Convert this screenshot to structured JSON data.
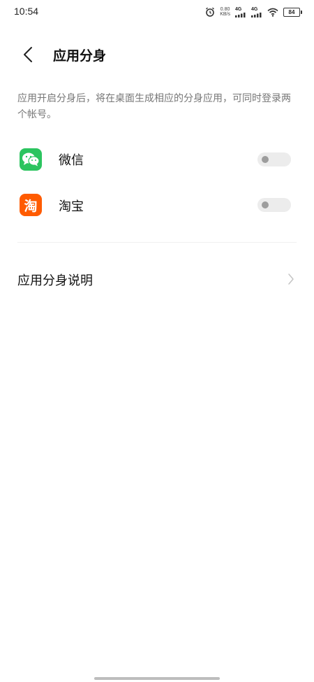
{
  "status_bar": {
    "time": "10:54",
    "net_speed_value": "0.80",
    "net_speed_unit": "KB/s",
    "sim1_label": "4G",
    "sim2_label": "4G",
    "battery_level": "84"
  },
  "header": {
    "title": "应用分身",
    "back_icon": "chevron-left-icon"
  },
  "description": "应用开启分身后，将在桌面生成相应的分身应用，可同时登录两个帐号。",
  "apps": [
    {
      "label": "微信",
      "icon": "wechat-icon",
      "icon_color": "#2BC45F",
      "enabled": false
    },
    {
      "label": "淘宝",
      "icon": "taobao-icon",
      "icon_color": "#FF5B00",
      "icon_text": "淘",
      "enabled": false
    }
  ],
  "explain": {
    "label": "应用分身说明",
    "icon": "chevron-right-icon"
  },
  "colors": {
    "toggle_off_track": "#ECECEC",
    "toggle_off_knob": "#9D9D9D",
    "description_text": "#777777"
  }
}
